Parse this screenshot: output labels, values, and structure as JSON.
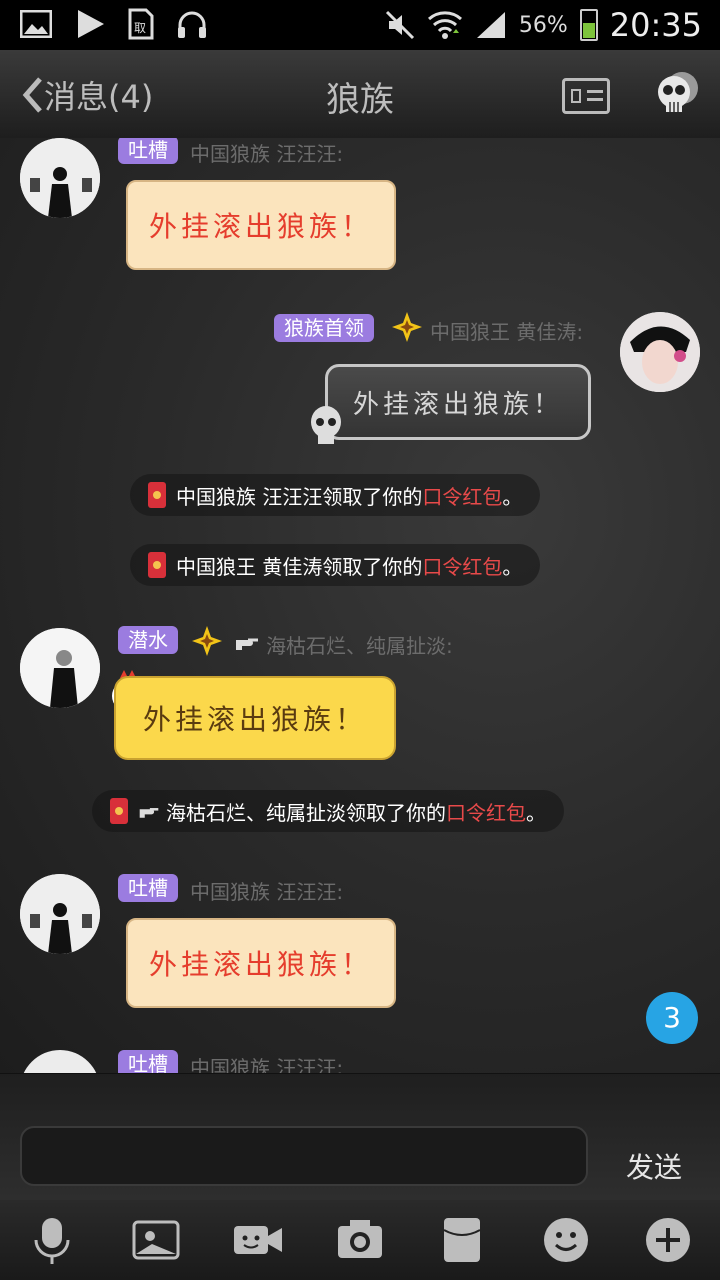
{
  "status_bar": {
    "time": "20:35",
    "battery_pct": "56%",
    "icons": [
      "image-icon",
      "play-icon",
      "sim-icon",
      "headphones-icon",
      "mute-icon",
      "wifi-icon",
      "signal-icon",
      "battery-icon"
    ]
  },
  "titlebar": {
    "back_label": "消息(4)",
    "title": "狼族"
  },
  "messages": [
    {
      "tag": "吐槽",
      "nick": "中国狼族 汪汪汪:",
      "text": "外挂滚出狼族！"
    },
    {
      "tag": "狼族首领",
      "nick": "中国狼王 黄佳涛:",
      "text": "外挂滚出狼族！"
    },
    {
      "tag": "潜水",
      "nick": "海枯石烂、纯属扯淡:",
      "text": "外挂滚出狼族！"
    },
    {
      "tag": "吐槽",
      "nick": "中国狼族 汪汪汪:",
      "text": "外挂滚出狼族！"
    },
    {
      "tag": "吐槽",
      "nick": "中国狼族 汪汪汪:"
    }
  ],
  "system_notices": [
    {
      "prefix": "中国狼族 汪汪汪领取了你的",
      "link": "口令红包",
      "suffix": "。"
    },
    {
      "prefix": "中国狼王 黄佳涛领取了你的",
      "link": "口令红包",
      "suffix": "。"
    },
    {
      "prefix": "海枯石烂、纯属扯淡领取了你的",
      "link": "口令红包",
      "suffix": "。"
    }
  ],
  "unread_badge": "3",
  "input": {
    "value": "",
    "send_label": "发送"
  },
  "colors": {
    "tag_purple": "#9b7ce0",
    "link_red": "#e84a4a",
    "badge_blue": "#27a4e4"
  },
  "toolbar": [
    "mic-icon",
    "image-icon",
    "video-icon",
    "camera-icon",
    "red-packet-icon",
    "emoji-icon",
    "plus-icon"
  ]
}
